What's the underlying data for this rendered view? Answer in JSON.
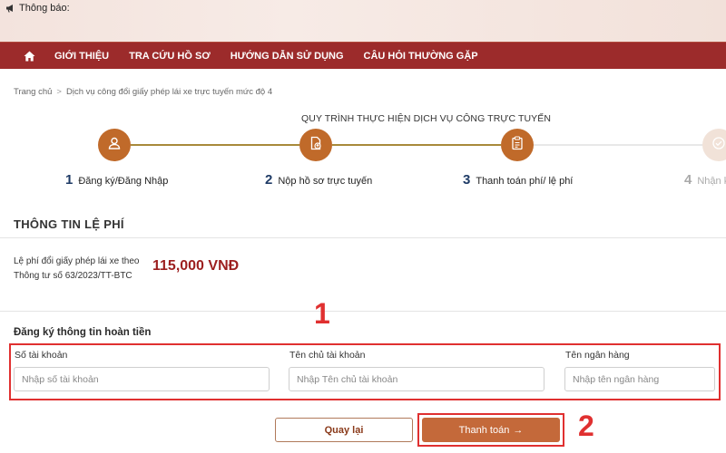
{
  "notice": {
    "label": "Thông báo:",
    "icon": "megaphone-icon"
  },
  "navbar": {
    "background": "#9c2b2b",
    "home_icon": "home-icon",
    "items": [
      {
        "label": "GIỚI THIỆU"
      },
      {
        "label": "TRA CỨU HỒ SƠ"
      },
      {
        "label": "HƯỚNG DẪN SỬ DỤNG"
      },
      {
        "label": "CÂU HỎI THƯỜNG GẶP"
      }
    ]
  },
  "breadcrumb": {
    "home": "Trang chủ",
    "separator": ">",
    "current": "Dịch vụ công đổi giấy phép lái xe trực tuyến mức độ 4"
  },
  "process": {
    "title": "QUY TRÌNH THỰC HIỆN DỊCH VỤ CÔNG TRỰC TUYẾN",
    "accent": "#c06a2a",
    "steps": [
      {
        "number": "1",
        "label": "Đăng ký/Đăng Nhập",
        "icon": "user-icon",
        "status": "done"
      },
      {
        "number": "2",
        "label": "Nộp hồ sơ trực tuyến",
        "icon": "document-upload-icon",
        "status": "done"
      },
      {
        "number": "3",
        "label": "Thanh toán phí/ lệ phí",
        "icon": "clipboard-icon",
        "status": "current"
      },
      {
        "number": "4",
        "label": "Nhận k",
        "icon": "check-circle-icon",
        "status": "pending"
      }
    ]
  },
  "fee": {
    "section_title": "THÔNG TIN LỆ PHÍ",
    "label": "Lệ phí đổi giấy phép lái xe theo Thông tư số 63/2023/TT-BTC",
    "amount": "115,000 VNĐ",
    "amount_color": "#9c1f1f"
  },
  "refund": {
    "title": "Đăng ký thông tin hoàn tiền",
    "fields": [
      {
        "label": "Số tài khoản",
        "placeholder": "Nhập số tài khoản",
        "value": ""
      },
      {
        "label": "Tên chủ tài khoản",
        "placeholder": "Nhập Tên chủ tài khoản",
        "value": ""
      },
      {
        "label": "Tên ngân hàng",
        "placeholder": "Nhập tên ngân hàng",
        "value": ""
      }
    ]
  },
  "actions": {
    "back_label": "Quay lại",
    "pay_label": "Thanh toán",
    "pay_arrow": "→",
    "pay_color": "#c4693a"
  },
  "annotations": {
    "marker_1": "1",
    "marker_2": "2",
    "highlight_color": "#e03030"
  }
}
